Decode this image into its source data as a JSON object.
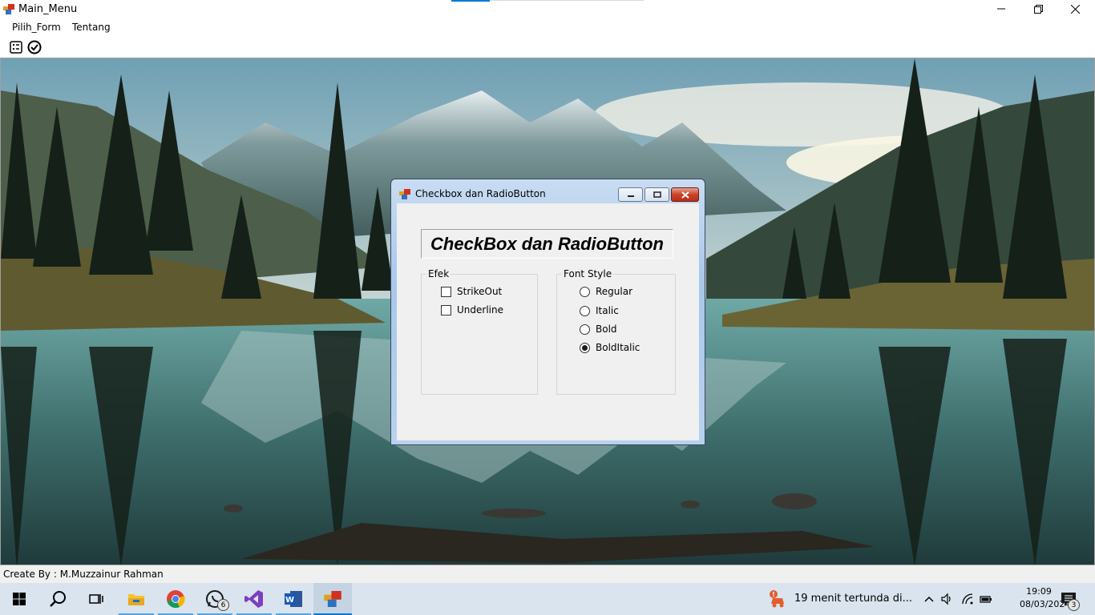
{
  "window": {
    "title": "Main_Menu",
    "controls": [
      "minimize-icon",
      "maximize-icon",
      "close-icon"
    ]
  },
  "menu": {
    "items": [
      "Pilih_Form",
      "Tentang"
    ]
  },
  "toolbar": {
    "buttons": [
      "form-list-icon",
      "check-circle-icon"
    ]
  },
  "child_window": {
    "title": "Checkbox dan RadioButton",
    "headline": "CheckBox dan RadioButton",
    "efek": {
      "legend": "Efek",
      "options": [
        {
          "label": "StrikeOut",
          "checked": false
        },
        {
          "label": "Underline",
          "checked": false
        }
      ]
    },
    "font_style": {
      "legend": "Font Style",
      "options": [
        {
          "label": "Regular",
          "selected": false
        },
        {
          "label": "Italic",
          "selected": false
        },
        {
          "label": "Bold",
          "selected": false
        },
        {
          "label": "BoldItalic",
          "selected": true
        }
      ]
    }
  },
  "statusbar": {
    "text": "Create By : M.Muzzainur Rahman"
  },
  "taskbar": {
    "apps": [
      "windows-start-icon",
      "search-icon",
      "task-view-icon",
      "file-explorer-icon",
      "chrome-icon",
      "whatsapp-icon",
      "visual-studio-icon",
      "word-icon",
      "app-window-icon"
    ],
    "whatsapp_badge": "6",
    "notification": "19 menit tertunda di...",
    "time": "19:09",
    "date": "08/03/2024",
    "action_center_badge": "3"
  },
  "colors": {
    "accent": "#0078d7",
    "taskbar": "#d9e4ee",
    "close_button": "#c8432a"
  }
}
